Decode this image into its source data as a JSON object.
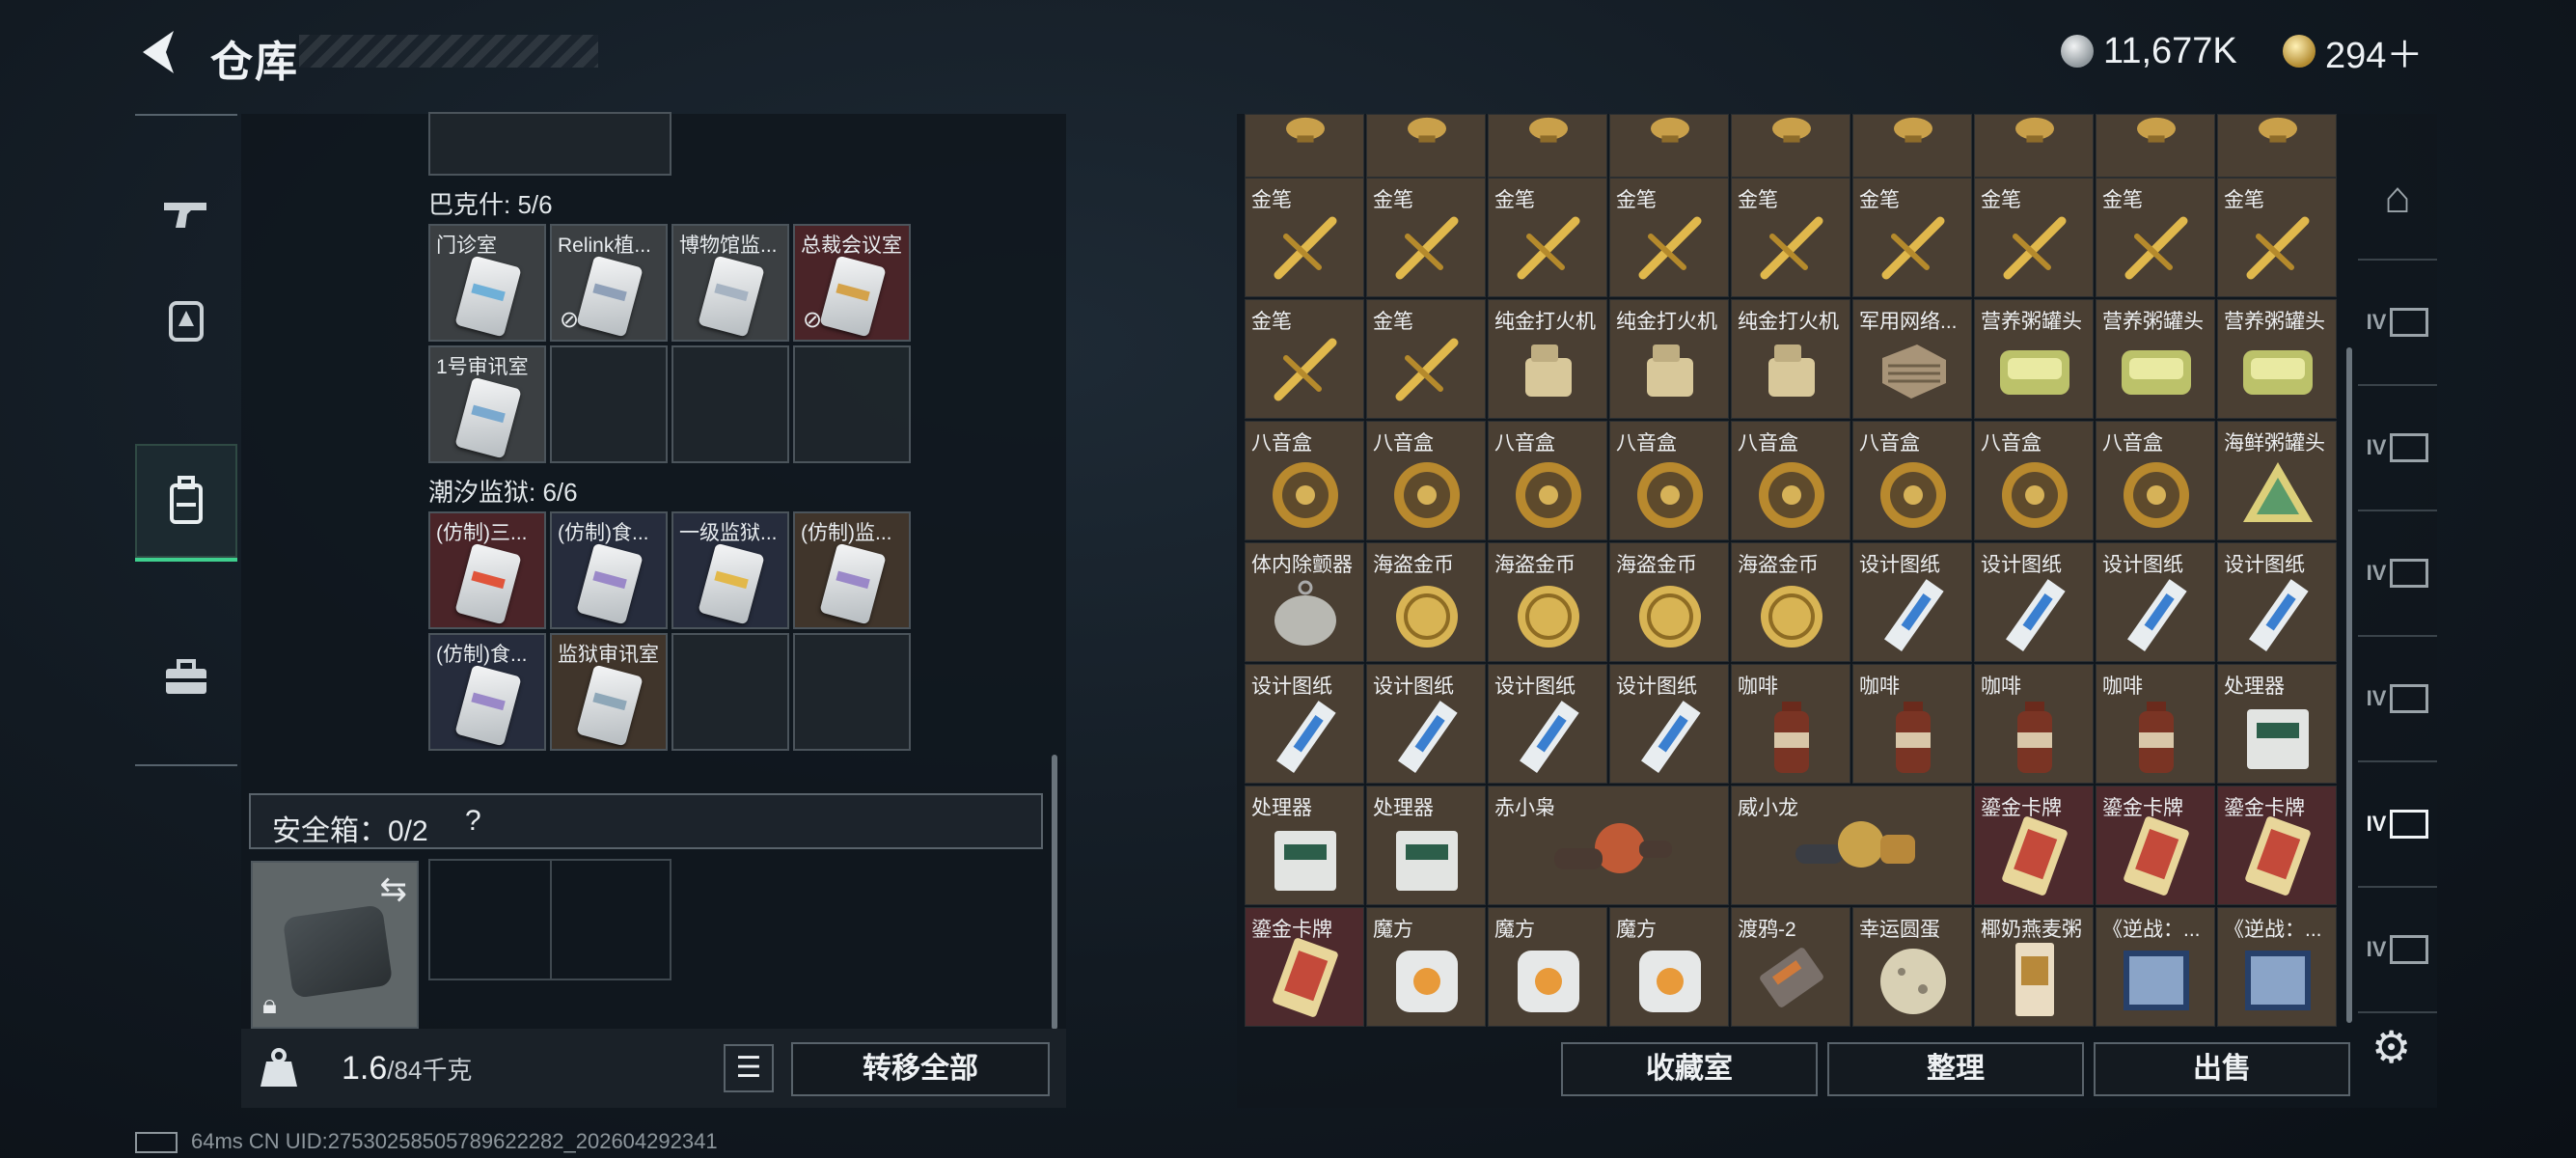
{
  "header": {
    "back_icon": "back-arrow-icon",
    "title": "仓库",
    "silver_amount": "11,677K",
    "gold_amount": "294＋"
  },
  "left_nav": {
    "items": [
      {
        "name": "gun-icon",
        "glyph": "⌐"
      },
      {
        "name": "armor-icon",
        "glyph": "⛨"
      },
      {
        "name": "backpack-icon",
        "glyph": "▣",
        "active": true
      },
      {
        "name": "toolbox-icon",
        "glyph": "⊞"
      }
    ]
  },
  "left_panel": {
    "group1": {
      "title": "巴克什: 5/6",
      "items": [
        {
          "label": "门诊室",
          "color": "#6fb0d8",
          "bg": "grey"
        },
        {
          "label": "Relink植...",
          "color": "#8fa0b8",
          "bg": "grey",
          "untradable": true
        },
        {
          "label": "博物馆监...",
          "color": "#a6b3c2",
          "bg": "grey"
        },
        {
          "label": "总裁会议室",
          "color": "#d4a24a",
          "bg": "red",
          "untradable": true
        },
        {
          "label": "1号审讯室",
          "color": "#7aa9cf",
          "bg": "grey"
        }
      ]
    },
    "group2": {
      "title": "潮汐监狱: 6/6",
      "items": [
        {
          "label": "(仿制)三...",
          "color": "#e0543a",
          "bg": "red"
        },
        {
          "label": "(仿制)食...",
          "color": "#9a88c8",
          "bg": "navy"
        },
        {
          "label": "一级监狱...",
          "color": "#e2b84a",
          "bg": "navy"
        },
        {
          "label": "(仿制)监...",
          "color": "#9a88c8",
          "bg": "brown"
        },
        {
          "label": "(仿制)食...",
          "color": "#9a88c8",
          "bg": "navy"
        },
        {
          "label": "监狱审讯室",
          "color": "#8ea7b8",
          "bg": "brown"
        }
      ]
    },
    "safebox": {
      "label": "安全箱：0/2",
      "help": "?"
    },
    "bottom": {
      "weight_current": "1.6",
      "weight_max": "/84千克",
      "transfer_all": "转移全部"
    }
  },
  "status_line": "64ms    CN UID:2753025850578962228​2_202604292341",
  "right_grid": {
    "rows": [
      [
        {
          "label": "",
          "icon": "gold-bust-icon",
          "bg": "brown"
        },
        {
          "label": "",
          "icon": "gold-bust-icon",
          "bg": "brown"
        },
        {
          "label": "",
          "icon": "gold-bust-icon",
          "bg": "brown"
        },
        {
          "label": "",
          "icon": "gold-bust-icon",
          "bg": "brown"
        },
        {
          "label": "",
          "icon": "gold-bust-icon",
          "bg": "brown"
        },
        {
          "label": "",
          "icon": "gold-bust-icon",
          "bg": "brown"
        },
        {
          "label": "",
          "icon": "gold-bust-icon",
          "bg": "brown"
        },
        {
          "label": "",
          "icon": "gold-bust-icon",
          "bg": "brown"
        },
        {
          "label": "",
          "icon": "gold-bust-icon",
          "bg": "brown"
        }
      ],
      [
        {
          "label": "金笔",
          "icon": "gold-pen-icon",
          "bg": "brown"
        },
        {
          "label": "金笔",
          "icon": "gold-pen-icon",
          "bg": "brown"
        },
        {
          "label": "金笔",
          "icon": "gold-pen-icon",
          "bg": "brown"
        },
        {
          "label": "金笔",
          "icon": "gold-pen-icon",
          "bg": "brown"
        },
        {
          "label": "金笔",
          "icon": "gold-pen-icon",
          "bg": "brown"
        },
        {
          "label": "金笔",
          "icon": "gold-pen-icon",
          "bg": "brown"
        },
        {
          "label": "金笔",
          "icon": "gold-pen-icon",
          "bg": "brown"
        },
        {
          "label": "金笔",
          "icon": "gold-pen-icon",
          "bg": "brown"
        },
        {
          "label": "金笔",
          "icon": "gold-pen-icon",
          "bg": "brown"
        }
      ],
      [
        {
          "label": "金笔",
          "icon": "gold-pen-icon",
          "bg": "brown"
        },
        {
          "label": "金笔",
          "icon": "gold-pen-icon",
          "bg": "brown"
        },
        {
          "label": "纯金打火机",
          "icon": "lighter-icon",
          "bg": "brown"
        },
        {
          "label": "纯金打火机",
          "icon": "lighter-icon",
          "bg": "brown"
        },
        {
          "label": "纯金打火机",
          "icon": "lighter-icon",
          "bg": "brown"
        },
        {
          "label": "军用网络...",
          "icon": "network-box-icon",
          "bg": "brown"
        },
        {
          "label": "营养粥罐头",
          "icon": "tin-can-icon",
          "bg": "brown"
        },
        {
          "label": "营养粥罐头",
          "icon": "tin-can-icon",
          "bg": "brown"
        },
        {
          "label": "营养粥罐头",
          "icon": "tin-can-icon",
          "bg": "brown"
        }
      ],
      [
        {
          "label": "八音盒",
          "icon": "music-box-icon",
          "bg": "brown"
        },
        {
          "label": "八音盒",
          "icon": "music-box-icon",
          "bg": "brown"
        },
        {
          "label": "八音盒",
          "icon": "music-box-icon",
          "bg": "brown"
        },
        {
          "label": "八音盒",
          "icon": "music-box-icon",
          "bg": "brown"
        },
        {
          "label": "八音盒",
          "icon": "music-box-icon",
          "bg": "brown"
        },
        {
          "label": "八音盒",
          "icon": "music-box-icon",
          "bg": "brown"
        },
        {
          "label": "八音盒",
          "icon": "music-box-icon",
          "bg": "brown"
        },
        {
          "label": "八音盒",
          "icon": "music-box-icon",
          "bg": "brown"
        },
        {
          "label": "海鲜粥罐头",
          "icon": "seafood-can-icon",
          "bg": "brown"
        }
      ],
      [
        {
          "label": "体内除颤器",
          "icon": "defibrillator-icon",
          "bg": "brown"
        },
        {
          "label": "海盗金币",
          "icon": "gold-coin-icon",
          "bg": "brown"
        },
        {
          "label": "海盗金币",
          "icon": "gold-coin-icon",
          "bg": "brown"
        },
        {
          "label": "海盗金币",
          "icon": "gold-coin-icon",
          "bg": "brown"
        },
        {
          "label": "海盗金币",
          "icon": "gold-coin-icon",
          "bg": "brown"
        },
        {
          "label": "设计图纸",
          "icon": "blueprint-icon",
          "bg": "brown"
        },
        {
          "label": "设计图纸",
          "icon": "blueprint-icon",
          "bg": "brown"
        },
        {
          "label": "设计图纸",
          "icon": "blueprint-icon",
          "bg": "brown"
        },
        {
          "label": "设计图纸",
          "icon": "blueprint-icon",
          "bg": "brown"
        }
      ],
      [
        {
          "label": "设计图纸",
          "icon": "blueprint-icon",
          "bg": "brown"
        },
        {
          "label": "设计图纸",
          "icon": "blueprint-icon",
          "bg": "brown"
        },
        {
          "label": "设计图纸",
          "icon": "blueprint-icon",
          "bg": "brown"
        },
        {
          "label": "设计图纸",
          "icon": "blueprint-icon",
          "bg": "brown"
        },
        {
          "label": "咖啡",
          "icon": "coffee-bottle-icon",
          "bg": "brown"
        },
        {
          "label": "咖啡",
          "icon": "coffee-bottle-icon",
          "bg": "brown"
        },
        {
          "label": "咖啡",
          "icon": "coffee-bottle-icon",
          "bg": "brown"
        },
        {
          "label": "咖啡",
          "icon": "coffee-bottle-icon",
          "bg": "brown"
        },
        {
          "label": "处理器",
          "icon": "processor-icon",
          "bg": "brown"
        }
      ],
      [
        {
          "label": "处理器",
          "icon": "processor-icon",
          "bg": "brown"
        },
        {
          "label": "处理器",
          "icon": "processor-icon",
          "bg": "brown"
        },
        {
          "label": "赤小枭",
          "icon": "figurine-red-icon",
          "bg": "brown",
          "wide": true
        },
        {
          "label": "威小龙",
          "icon": "figurine-gold-icon",
          "bg": "brown",
          "wide": true
        },
        {
          "label": "鎏金卡牌",
          "icon": "gilded-card-icon",
          "bg": "red"
        },
        {
          "label": "鎏金卡牌",
          "icon": "gilded-card-icon",
          "bg": "red"
        },
        {
          "label": "鎏金卡牌",
          "icon": "gilded-card-icon",
          "bg": "red"
        }
      ],
      [
        {
          "label": "鎏金卡牌",
          "icon": "gilded-card-icon",
          "bg": "red"
        },
        {
          "label": "魔方",
          "icon": "cube-icon",
          "bg": "brown"
        },
        {
          "label": "魔方",
          "icon": "cube-icon",
          "bg": "brown"
        },
        {
          "label": "魔方",
          "icon": "cube-icon",
          "bg": "brown"
        },
        {
          "label": "渡鸦-2",
          "icon": "raven-device-icon",
          "bg": "brown"
        },
        {
          "label": "幸运圆蛋",
          "icon": "lucky-egg-icon",
          "bg": "brown"
        },
        {
          "label": "椰奶燕麦粥",
          "icon": "porridge-box-icon",
          "bg": "brown"
        },
        {
          "label": "《逆战：...",
          "icon": "game-box-icon",
          "bg": "brown"
        },
        {
          "label": "《逆战：...",
          "icon": "game-box-icon",
          "bg": "brown"
        }
      ]
    ]
  },
  "right_bottom": {
    "collection": "收藏室",
    "sort": "整理",
    "sell": "出售"
  },
  "side_tabs": [
    {
      "name": "vault-icon",
      "glyph": "⌂"
    },
    {
      "name": "tab-iv-folder-icon",
      "glyph": "IV"
    },
    {
      "name": "tab-iv-medkit-icon",
      "glyph": "IV"
    },
    {
      "name": "tab-iv-rifle-icon",
      "glyph": "IV"
    },
    {
      "name": "tab-iv-gun-icon",
      "glyph": "IV"
    },
    {
      "name": "tab-iv-case-icon",
      "glyph": "IV",
      "active": true
    },
    {
      "name": "tab-iv-misc-icon",
      "glyph": "IV"
    }
  ]
}
